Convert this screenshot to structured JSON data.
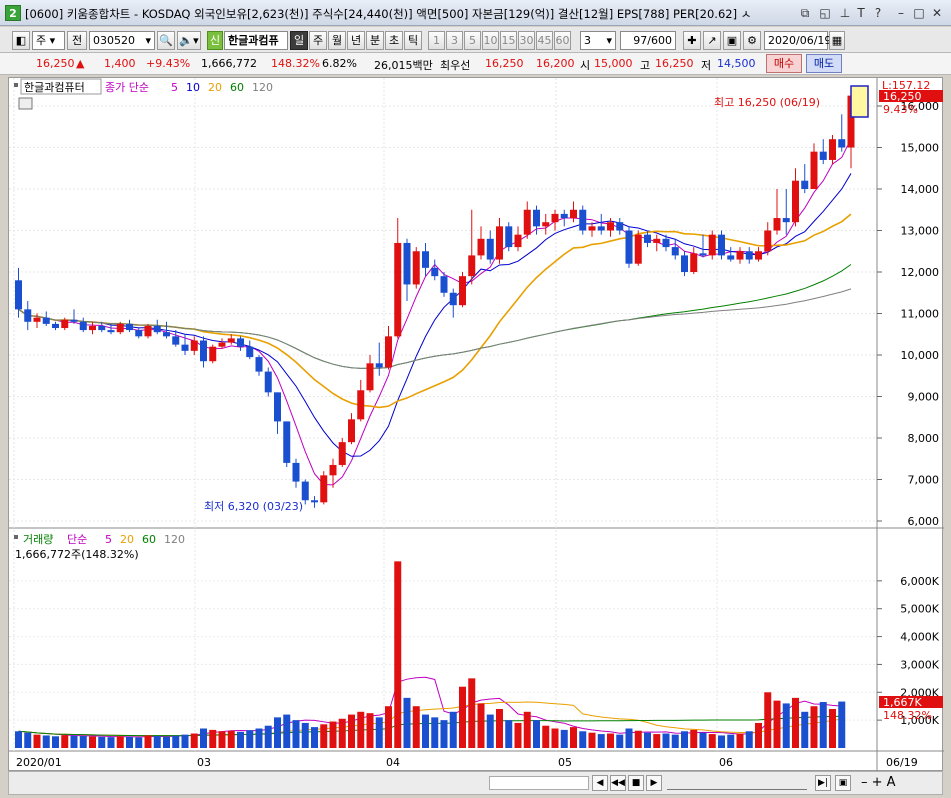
{
  "window": {
    "title": "[0600] 키움종합차트 - KOSDAQ 외국인보유[2,623(천)] 주식수[24,440(천)] 액면[500] 자본금[129(억)] 결산[12월] EPS[788] PER[20.62] ㅅ",
    "app_icon_label": "2"
  },
  "toolbar": {
    "period_select": "주",
    "compare_label": "전",
    "stock_code": "030520",
    "new_badge": "신",
    "stock_name": "한글과컴퓨",
    "period_tabs": [
      "일",
      "주",
      "월",
      "년",
      "분",
      "초",
      "틱"
    ],
    "active_period": "일",
    "interval_buttons": [
      "1",
      "3",
      "5",
      "10",
      "15",
      "30",
      "45",
      "60"
    ],
    "interval_input": "3",
    "count": "97/600",
    "date": "2020/06/19"
  },
  "quote": {
    "price": "16,250",
    "change_arrow": "▲",
    "change": "1,400",
    "change_pct": "+9.43%",
    "volume": "1,666,772",
    "volume_ratio": "148.32%",
    "turnover": "6.82%",
    "amount": "26,015백만",
    "best_ask_label": "최우선",
    "best_ask": "16,250",
    "best_bid": "16,200",
    "open_label": "시",
    "open": "15,000",
    "high_label": "고",
    "high": "16,250",
    "low_label": "저",
    "low": "14,500",
    "buy_button": "매수",
    "sell_button": "매도"
  },
  "price_panel": {
    "legend_name": "한글과컴퓨터",
    "ma_label": "종가 단순",
    "ma_periods": [
      "5",
      "10",
      "20",
      "60",
      "120"
    ],
    "ma_colors": [
      "#c000c0",
      "#0000d0",
      "#e8a000",
      "#008000",
      "#808080"
    ],
    "high_annotation": "최고 16,250 (06/19)",
    "low_annotation": "최저 6,320 (03/23)",
    "last_price_tag": "16,250",
    "last_change_tag": "9.43%",
    "top_tag": "L:157.12",
    "y_ticks": [
      "16,000",
      "15,000",
      "14,000",
      "13,000",
      "12,000",
      "11,000",
      "10,000",
      "9,000",
      "8,000",
      "7,000",
      "6,000"
    ]
  },
  "volume_panel": {
    "legend_name": "거래량",
    "ma_label": "단순",
    "ma_periods": [
      "5",
      "20",
      "60",
      "120"
    ],
    "current_value": "1,666,772주(148.32%)",
    "last_tag": "1,667K",
    "last_pct_tag": "148.32%",
    "y_ticks": [
      "6,000K",
      "5,000K",
      "4,000K",
      "3,000K",
      "2,000K",
      "1,000K"
    ]
  },
  "x_axis_labels": [
    "2020/01",
    "03",
    "04",
    "05",
    "06",
    "06/19"
  ],
  "colors": {
    "up": "#e01010",
    "down": "#1a4fd0",
    "accent": "#7bbf3e"
  },
  "chart_data": {
    "type": "candlestick",
    "title": "한글과컴퓨터",
    "ylim": [
      6000,
      16500
    ],
    "volume_ylim": [
      0,
      7000
    ],
    "candles": [
      [
        11800,
        12100,
        10900,
        11100
      ],
      [
        11100,
        11300,
        10600,
        10800
      ],
      [
        10800,
        11000,
        10650,
        10900
      ],
      [
        10900,
        11050,
        10700,
        10750
      ],
      [
        10750,
        10800,
        10600,
        10650
      ],
      [
        10650,
        10900,
        10600,
        10850
      ],
      [
        10850,
        11100,
        10750,
        10800
      ],
      [
        10800,
        10900,
        10550,
        10600
      ],
      [
        10600,
        10800,
        10500,
        10700
      ],
      [
        10700,
        10800,
        10550,
        10600
      ],
      [
        10600,
        10750,
        10500,
        10550
      ],
      [
        10550,
        10800,
        10500,
        10750
      ],
      [
        10750,
        10850,
        10550,
        10600
      ],
      [
        10600,
        10650,
        10400,
        10450
      ],
      [
        10450,
        10750,
        10400,
        10700
      ],
      [
        10700,
        10850,
        10500,
        10550
      ],
      [
        10550,
        10800,
        10400,
        10450
      ],
      [
        10450,
        10600,
        10200,
        10250
      ],
      [
        10250,
        10500,
        10000,
        10100
      ],
      [
        10100,
        10450,
        10000,
        10350
      ],
      [
        10350,
        10450,
        9700,
        9850
      ],
      [
        9850,
        10250,
        9800,
        10200
      ],
      [
        10200,
        10400,
        10150,
        10300
      ],
      [
        10300,
        10500,
        10250,
        10400
      ],
      [
        10400,
        10450,
        10100,
        10200
      ],
      [
        10200,
        10350,
        9900,
        9950
      ],
      [
        9950,
        10000,
        9500,
        9600
      ],
      [
        9600,
        9700,
        9000,
        9100
      ],
      [
        9100,
        9100,
        8100,
        8400
      ],
      [
        8400,
        8400,
        7300,
        7400
      ],
      [
        7400,
        7500,
        6800,
        6950
      ],
      [
        6950,
        7000,
        6400,
        6500
      ],
      [
        6500,
        6600,
        6320,
        6450
      ],
      [
        6450,
        7200,
        6400,
        7100
      ],
      [
        7100,
        7500,
        6800,
        7350
      ],
      [
        7350,
        8000,
        7300,
        7900
      ],
      [
        7900,
        8600,
        7850,
        8450
      ],
      [
        8450,
        9400,
        8400,
        9150
      ],
      [
        9150,
        10000,
        9100,
        9800
      ],
      [
        9800,
        10300,
        9500,
        9700
      ],
      [
        9700,
        10700,
        9650,
        10450
      ],
      [
        10450,
        13300,
        10400,
        12700
      ],
      [
        12700,
        12800,
        11300,
        11700
      ],
      [
        11700,
        12600,
        11600,
        12500
      ],
      [
        12500,
        12700,
        11900,
        12100
      ],
      [
        12100,
        12300,
        11800,
        11900
      ],
      [
        11900,
        12000,
        11400,
        11500
      ],
      [
        11500,
        11600,
        10900,
        11200
      ],
      [
        11200,
        12000,
        11150,
        11900
      ],
      [
        11900,
        13500,
        11700,
        12400
      ],
      [
        12400,
        13100,
        12300,
        12800
      ],
      [
        12800,
        13000,
        12200,
        12300
      ],
      [
        12300,
        13300,
        12200,
        13100
      ],
      [
        13100,
        13200,
        12500,
        12600
      ],
      [
        12600,
        13100,
        12500,
        12900
      ],
      [
        12900,
        13700,
        12800,
        13500
      ],
      [
        13500,
        13600,
        12900,
        13100
      ],
      [
        13100,
        13400,
        12900,
        13200
      ],
      [
        13200,
        13500,
        13000,
        13400
      ],
      [
        13400,
        13500,
        13100,
        13300
      ],
      [
        13300,
        13700,
        13200,
        13500
      ],
      [
        13500,
        13600,
        12900,
        13000
      ],
      [
        13000,
        13200,
        12850,
        13100
      ],
      [
        13100,
        13400,
        12900,
        13000
      ],
      [
        13000,
        13300,
        12850,
        13200
      ],
      [
        13200,
        13300,
        12900,
        13000
      ],
      [
        13000,
        13100,
        12100,
        12200
      ],
      [
        12200,
        13000,
        12150,
        12900
      ],
      [
        12900,
        13000,
        12600,
        12700
      ],
      [
        12700,
        12900,
        12500,
        12800
      ],
      [
        12800,
        12900,
        12500,
        12600
      ],
      [
        12600,
        12800,
        12300,
        12400
      ],
      [
        12400,
        12500,
        11900,
        12000
      ],
      [
        12000,
        12600,
        11950,
        12450
      ],
      [
        12450,
        12900,
        12350,
        12400
      ],
      [
        12400,
        13000,
        12300,
        12900
      ],
      [
        12900,
        13000,
        12300,
        12400
      ],
      [
        12400,
        12600,
        12250,
        12300
      ],
      [
        12300,
        12600,
        12200,
        12500
      ],
      [
        12500,
        12600,
        12200,
        12300
      ],
      [
        12300,
        12600,
        12250,
        12500
      ],
      [
        12500,
        13200,
        12400,
        13000
      ],
      [
        13000,
        14000,
        12900,
        13300
      ],
      [
        13300,
        14000,
        12900,
        13200
      ],
      [
        13200,
        14500,
        13100,
        14200
      ],
      [
        14200,
        14600,
        13900,
        14000
      ],
      [
        14000,
        15100,
        14000,
        14900
      ],
      [
        14900,
        15200,
        14600,
        14700
      ],
      [
        14700,
        15300,
        14600,
        15200
      ],
      [
        15200,
        15800,
        14900,
        15000
      ],
      [
        15000,
        16250,
        14500,
        16250
      ]
    ],
    "volume_k": [
      600,
      550,
      480,
      450,
      420,
      460,
      440,
      430,
      410,
      400,
      390,
      420,
      400,
      380,
      450,
      430,
      410,
      440,
      480,
      520,
      700,
      650,
      600,
      620,
      580,
      640,
      700,
      800,
      1100,
      1200,
      1000,
      900,
      750,
      850,
      950,
      1050,
      1200,
      1300,
      1250,
      1100,
      1500,
      6700,
      1800,
      1500,
      1200,
      1100,
      1000,
      1300,
      2200,
      2500,
      1600,
      1200,
      1400,
      1000,
      900,
      1300,
      1000,
      800,
      700,
      650,
      750,
      600,
      550,
      500,
      520,
      480,
      700,
      620,
      550,
      500,
      520,
      480,
      600,
      650,
      550,
      500,
      450,
      480,
      520,
      600,
      900,
      2000,
      1700,
      1600,
      1800,
      1300,
      1500,
      1650,
      1400,
      1667
    ]
  }
}
